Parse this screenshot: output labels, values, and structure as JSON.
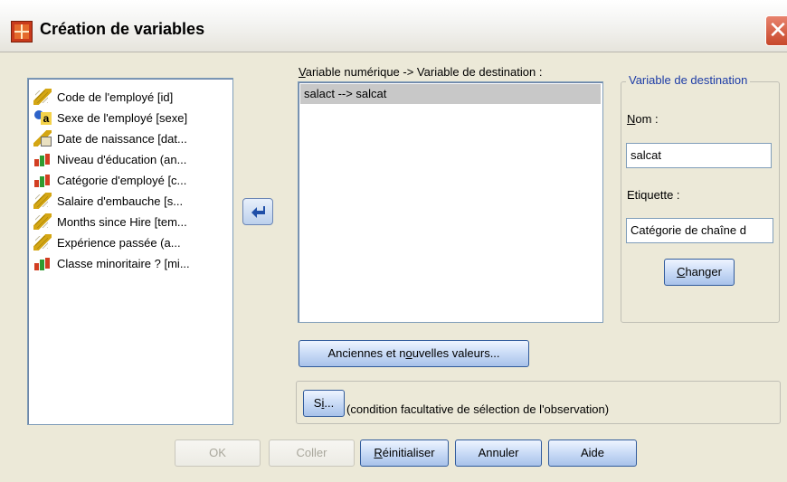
{
  "window": {
    "title": "Création de variables",
    "close_glyph": "✕"
  },
  "source_list": {
    "items": [
      {
        "label": "Code de l'employé [id]",
        "icon": "ruler-icon"
      },
      {
        "label": "Sexe de l'employé [sexe]",
        "icon": "nominal-icon"
      },
      {
        "label": "Date de naissance [dat...",
        "icon": "date-icon"
      },
      {
        "label": "Niveau d'éducation (an...",
        "icon": "ordinal-icon"
      },
      {
        "label": "Catégorie d'employé [c...",
        "icon": "ordinal-icon"
      },
      {
        "label": "Salaire d'embauche [s...",
        "icon": "ruler-icon"
      },
      {
        "label": "Months since Hire [tem...",
        "icon": "ruler-icon"
      },
      {
        "label": "Expérience passée (a...",
        "icon": "ruler-icon"
      },
      {
        "label": "Classe minoritaire ? [mi...",
        "icon": "ordinal-icon"
      }
    ]
  },
  "mapping": {
    "label_pre": "V",
    "label_post": "ariable numérique -> Variable de destination :",
    "rows": [
      "salact --> salcat"
    ]
  },
  "destination": {
    "legend": "Variable de destination",
    "name_label_u": "N",
    "name_label_rest": "om :",
    "name_value": "salcat",
    "label_label": "Etiquette :",
    "label_value": "Catégorie de chaîne d",
    "change_u": "C",
    "change_rest": "hanger"
  },
  "buttons": {
    "old_new_pre": "Anciennes et n",
    "old_new_u": "o",
    "old_new_post": "uvelles valeurs...",
    "if_pre": "S",
    "if_u": "i",
    "if_post": "...",
    "condition_text": "(condition facultative de sélection de l'observation)",
    "ok": "OK",
    "paste": "Coller",
    "reset_pre": "",
    "reset_u": "R",
    "reset_post": "éinitialiser",
    "cancel": "Annuler",
    "help": "Aide"
  }
}
